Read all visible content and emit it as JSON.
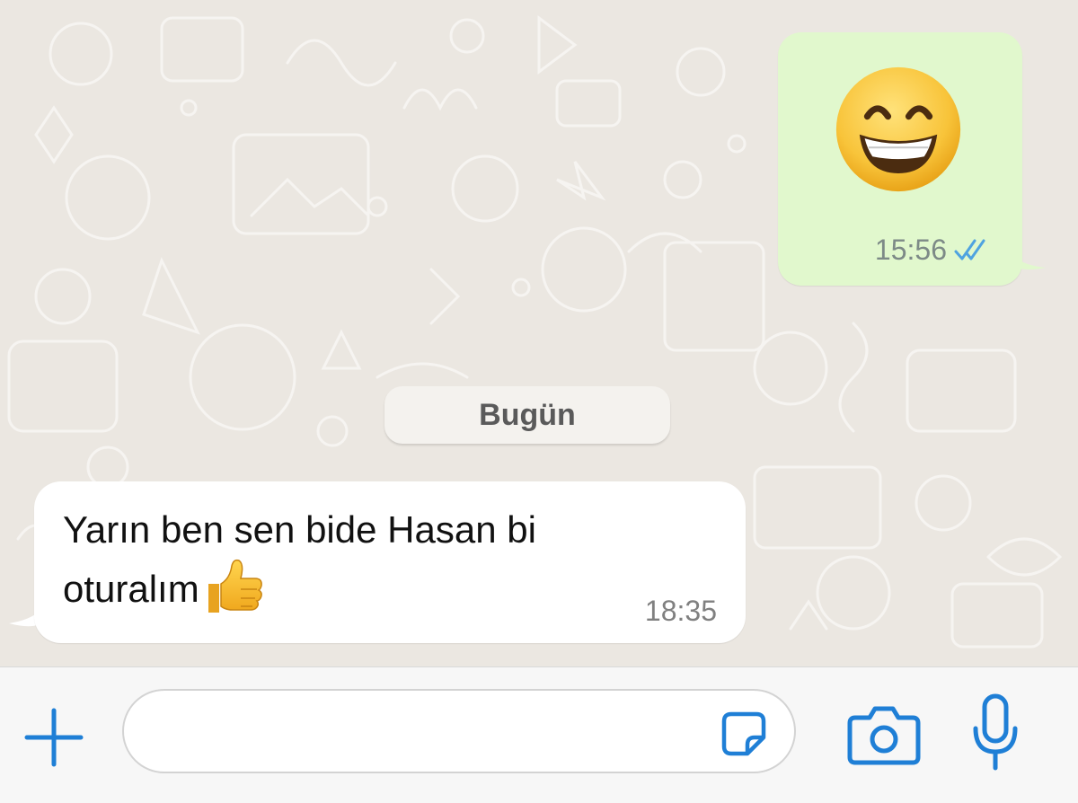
{
  "chat": {
    "outgoing": {
      "emoji_icon": "grinning-face-with-smiling-eyes-icon",
      "time": "15:56",
      "status_icon": "double-check-read-icon",
      "bubble_color": "#e1f8cd",
      "tick_color": "#4fa3e0"
    },
    "date_separator": "Bugün",
    "incoming": {
      "text_line1": "Yarın ben sen bide Hasan bi",
      "text_line2": "oturalım",
      "emoji_icon": "thumbs-up-icon",
      "time": "18:35",
      "bubble_color": "#ffffff"
    }
  },
  "input_bar": {
    "plus_icon": "plus-icon",
    "message_value": "",
    "sticker_icon": "sticker-icon",
    "camera_icon": "camera-icon",
    "mic_icon": "microphone-icon",
    "accent_color": "#1f7fd6"
  }
}
